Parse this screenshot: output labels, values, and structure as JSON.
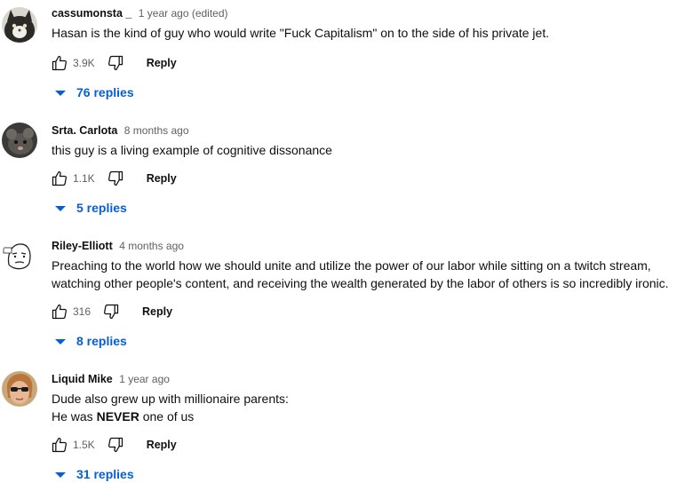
{
  "comments": [
    {
      "author": "cassumonsta _",
      "time": "1 year ago (edited)",
      "text": "Hasan is the kind of guy who would write \"Fuck Capitalism\" on to the side of his private jet.",
      "likes": "3.9K",
      "reply_label": "Reply",
      "replies_label": "76 replies",
      "avatar_icon": "cat-avatar-icon"
    },
    {
      "author": "Srta. Carlota",
      "time": "8 months ago",
      "text": "this guy is a living example of cognitive dissonance",
      "likes": "1.1K",
      "reply_label": "Reply",
      "replies_label": "5 replies",
      "avatar_icon": "rat-avatar-icon"
    },
    {
      "author": "Riley-Elliott",
      "time": "4 months ago",
      "text_line1": "Preaching to the world how we should unite and utilize the power of our labor while sitting on a twitch stream,",
      "text_line2": "watching other people's content, and receiving the wealth generated by the labor of others is so incredibly ironic.",
      "likes": "316",
      "reply_label": "Reply",
      "replies_label": "8 replies",
      "avatar_icon": "sketch-face-avatar-icon"
    },
    {
      "author": "Liquid Mike",
      "time": "1 year ago",
      "text_line1": "Dude also grew up with millionaire parents:",
      "text_line2_pre": "He was ",
      "text_line2_bold": "NEVER",
      "text_line2_post": " one of us",
      "likes": "1.5K",
      "reply_label": "Reply",
      "replies_label": "31 replies",
      "avatar_icon": "sunglasses-man-avatar-icon"
    }
  ],
  "colors": {
    "link_blue": "#065fd4",
    "meta_gray": "#606060",
    "text": "#0f0f0f"
  }
}
